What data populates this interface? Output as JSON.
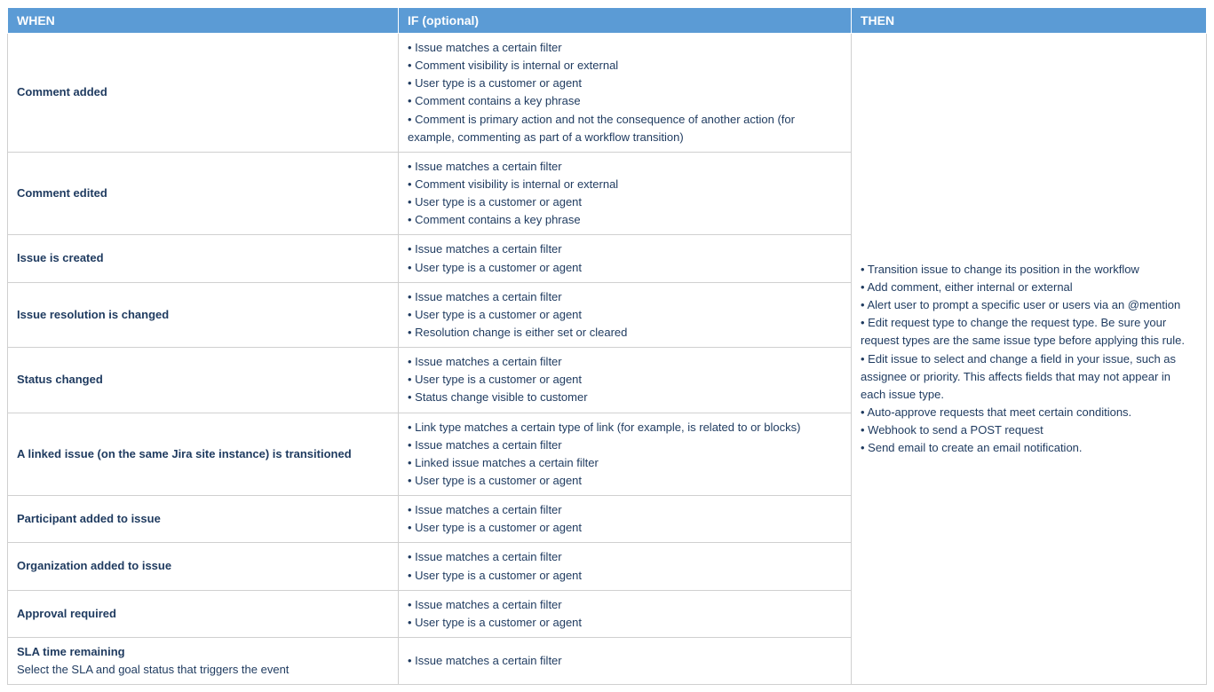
{
  "headers": {
    "when": "WHEN",
    "if": "IF (optional)",
    "then": "THEN"
  },
  "rows": [
    {
      "when": "Comment added",
      "sub": "",
      "if": [
        "Issue matches a certain filter",
        "Comment visibility is internal or external",
        "User type is a customer or agent",
        "Comment contains a key phrase",
        "Comment is primary action and not the consequence of another action (for example, commenting as part of a workflow transition)"
      ]
    },
    {
      "when": "Comment edited",
      "sub": "",
      "if": [
        "Issue matches a certain filter",
        "Comment visibility is internal or external",
        "User type is a customer or agent",
        "Comment contains a key phrase"
      ]
    },
    {
      "when": "Issue is created",
      "sub": "",
      "if": [
        "Issue matches a certain filter",
        "User type is a customer or agent"
      ]
    },
    {
      "when": "Issue resolution is changed",
      "sub": "",
      "if": [
        "Issue matches a certain filter",
        "User type is a customer or agent",
        "Resolution change is either set or cleared"
      ]
    },
    {
      "when": "Status changed",
      "sub": "",
      "if": [
        "Issue matches a certain filter",
        "User type is a customer or agent",
        "Status change visible to customer"
      ]
    },
    {
      "when": "A linked issue (on the same Jira site instance) is transitioned",
      "sub": "",
      "if": [
        "Link type matches a certain type of link (for example, is related to or blocks)",
        "Issue matches a certain filter",
        "Linked issue matches  a certain filter",
        "User type is a customer or agent"
      ]
    },
    {
      "when": "Participant added to issue",
      "sub": "",
      "if": [
        "Issue matches a certain filter",
        "User type is a customer or agent"
      ]
    },
    {
      "when": "Organization added to issue",
      "sub": "",
      "if": [
        "Issue matches a certain filter",
        "User type is a customer or agent"
      ]
    },
    {
      "when": "Approval required",
      "sub": "",
      "if": [
        "Issue matches a certain filter",
        "User type is a customer or agent"
      ]
    },
    {
      "when": "SLA time remaining",
      "sub": "Select the SLA and goal status that triggers the event",
      "if": [
        "Issue matches a certain filter"
      ]
    }
  ],
  "then": [
    "Transition issue to change its position in the workflow",
    "Add comment, either internal or external",
    "Alert user to prompt a specific user or users via an @mention",
    "Edit request type to change the request type. Be sure your request types are the same issue type before applying this rule.",
    "Edit issue to select and change a field in your issue, such as assignee or priority. This affects fields that may not appear in each issue type.",
    "Auto-approve requests that meet certain conditions.",
    "Webhook to send a POST request",
    "Send email to create an email notification."
  ]
}
